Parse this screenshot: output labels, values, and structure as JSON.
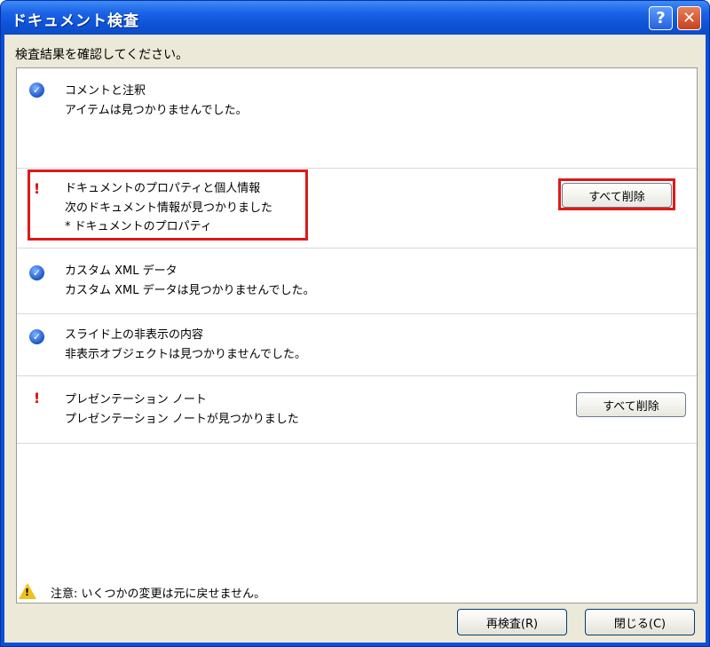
{
  "window": {
    "title": "ドキュメント検査",
    "help_label": "?",
    "close_label": "✕"
  },
  "prompt": "検査結果を確認してください。",
  "items": [
    {
      "status": "ok",
      "title": "コメントと注釈",
      "desc": "アイテムは見つかりませんでした。"
    },
    {
      "status": "warning",
      "title": "ドキュメントのプロパティと個人情報",
      "desc": "次のドキュメント情報が見つかりました",
      "sub": "* ドキュメントのプロパティ",
      "button": "すべて削除"
    },
    {
      "status": "ok",
      "title": "カスタム XML データ",
      "desc": "カスタム XML データは見つかりませんでした。"
    },
    {
      "status": "ok",
      "title": "スライド上の非表示の内容",
      "desc": "非表示オブジェクトは見つかりませんでした。"
    },
    {
      "status": "warning",
      "title": "プレゼンテーション ノート",
      "desc": "プレゼンテーション ノートが見つかりました",
      "button": "すべて削除"
    }
  ],
  "icons": {
    "ok": "check-icon",
    "warning": "exclamation-icon",
    "footer": "warning-triangle-icon"
  },
  "footer": {
    "warning": "注意: いくつかの変更は元に戻せません。",
    "reinspect_button": "再検査(R)",
    "close_button": "閉じる(C)"
  },
  "colors": {
    "titlebar": "#0a4fd6",
    "highlight": "#e01818",
    "warning_icon": "#d01010",
    "ok_icon": "#1a55c8"
  }
}
